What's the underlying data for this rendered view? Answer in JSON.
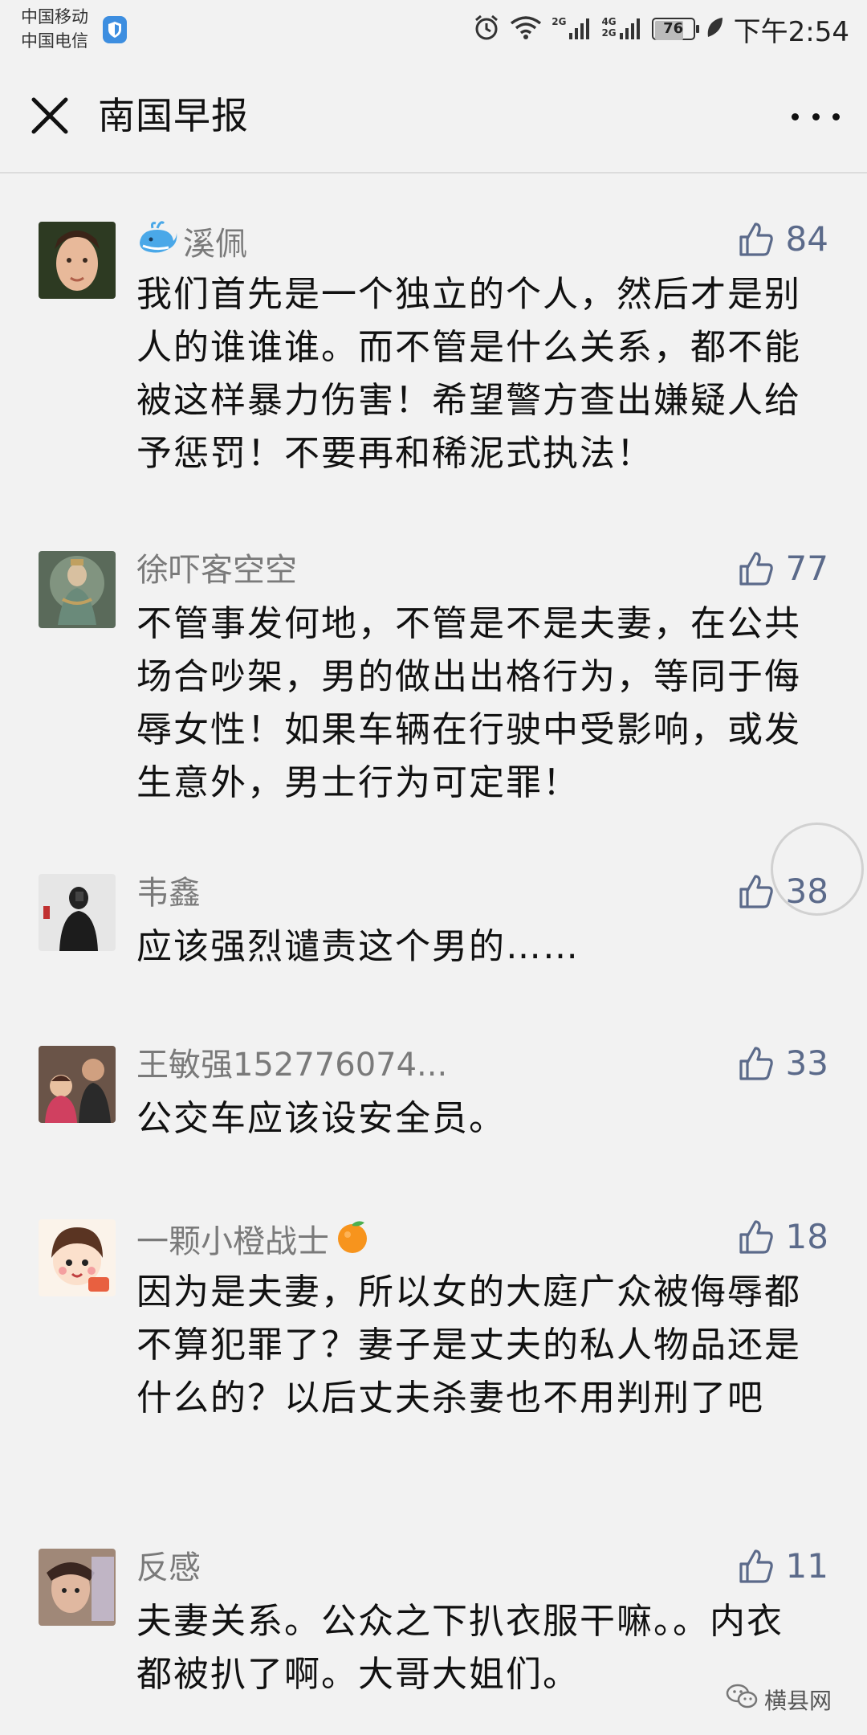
{
  "status_bar": {
    "carrier_1": "中国移动",
    "carrier_2": "中国电信",
    "net_2g": "2G",
    "net_4g": "4G",
    "net_2g_b": "2G",
    "battery": "76",
    "battery_level": 0.76,
    "time": "下午2:54"
  },
  "header": {
    "title": "南国早报"
  },
  "comments": [
    {
      "name": "溪佩",
      "likes": "84",
      "text": "我们首先是一个独立的个人，然后才是别人的谁谁谁。而不管是什么关系，都不能被这样暴力伤害！希望警方查出嫌疑人给予惩罚！不要再和稀泥式执法！"
    },
    {
      "name": "徐吓客空空",
      "likes": "77",
      "text": "不管事发何地，不管是不是夫妻，在公共场合吵架，男的做出出格行为，等同于侮辱女性！如果车辆在行驶中受影响，或发生意外，男士行为可定罪！"
    },
    {
      "name": "韦鑫",
      "likes": "38",
      "text": "应该强烈谴责这个男的……"
    },
    {
      "name": "王敏强152776074...",
      "likes": "33",
      "text": "公交车应该设安全员。"
    },
    {
      "name": "一颗小橙战士",
      "likes": "18",
      "text": "因为是夫妻，所以女的大庭广众被侮辱都不算犯罪了？妻子是丈夫的私人物品还是什么的？以后丈夫杀妻也不用判刑了吧"
    },
    {
      "name": "反感",
      "likes": "11",
      "text": "夫妻关系。公众之下扒衣服干嘛。。内衣都被扒了啊。大哥大姐们。"
    }
  ],
  "watermark": {
    "text": "横县网"
  },
  "colors": {
    "like": "#5b6a8a",
    "name": "#7a7a7a",
    "background": "#f2f2f2"
  }
}
